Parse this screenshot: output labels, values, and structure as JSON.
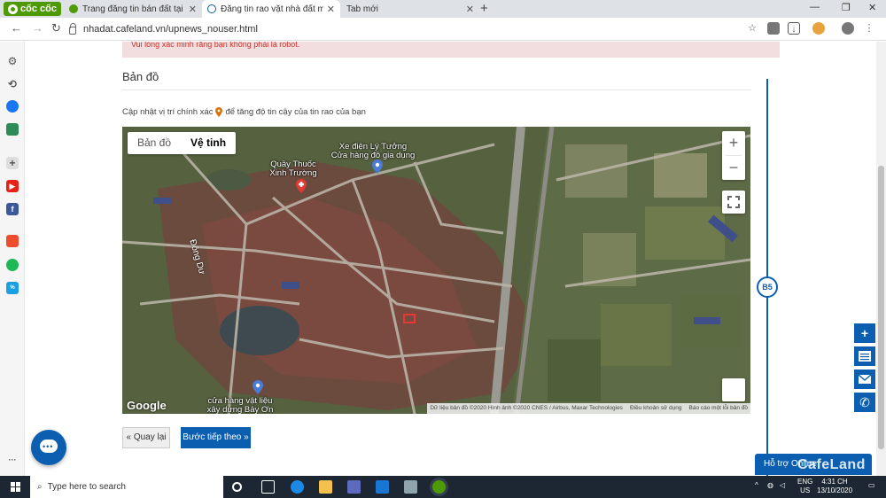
{
  "browser": {
    "brand": "cốc cốc",
    "tabs": [
      {
        "label": "Trang đăng tin bán đất tại hà nội",
        "active": false
      },
      {
        "label": "Đăng tin rao vặt nhà đất miễn phí",
        "active": true
      },
      {
        "label": "Tab mới",
        "active": false
      }
    ],
    "url": "nhadat.cafeland.vn/upnews_nouser.html"
  },
  "page": {
    "alert_text": "Vui lòng xác minh rằng bạn không phải là robot.",
    "section_title": "Bản đồ",
    "hint_before": "Cập nhật vị trí chính xác",
    "hint_after": "để tăng độ tin cậy của tin rao của bạn",
    "step_label": "B5",
    "back_button": "« Quay lại",
    "next_button": "Bước tiếp theo »"
  },
  "map": {
    "type_map": "Bản đồ",
    "type_satellite": "Vệ tinh",
    "zoom_in": "+",
    "zoom_out": "−",
    "google": "Google",
    "places": [
      {
        "name": "Xe điện Lý Tưởng",
        "sub": "Cửa hàng đồ gia dụng"
      },
      {
        "name": "Quầy Thuốc Xinh Trường",
        "sub": ""
      },
      {
        "name": "cửa hàng vật liệu xây dựng Bảy Ơn",
        "sub": ""
      }
    ],
    "street": "Đông Dư",
    "attribution": [
      "Dữ liệu bản đồ ©2020 Hình ảnh ©2020 CNES / Airbus, Maxar Technologies",
      "Điều khoản sử dụng",
      "Báo cáo một lỗi bản đồ"
    ]
  },
  "widgets": {
    "support": "Hỗ trợ Online",
    "watermark": "CafeLand"
  },
  "taskbar": {
    "search_placeholder": "Type here to search",
    "lang": "ENG",
    "region": "US",
    "time": "4:31 CH",
    "date": "13/10/2020"
  },
  "colors": {
    "primary": "#0c5eb0",
    "alert_bg": "#f2dede",
    "alert_text": "#c9302c",
    "cococ_green": "#4e9a06"
  }
}
